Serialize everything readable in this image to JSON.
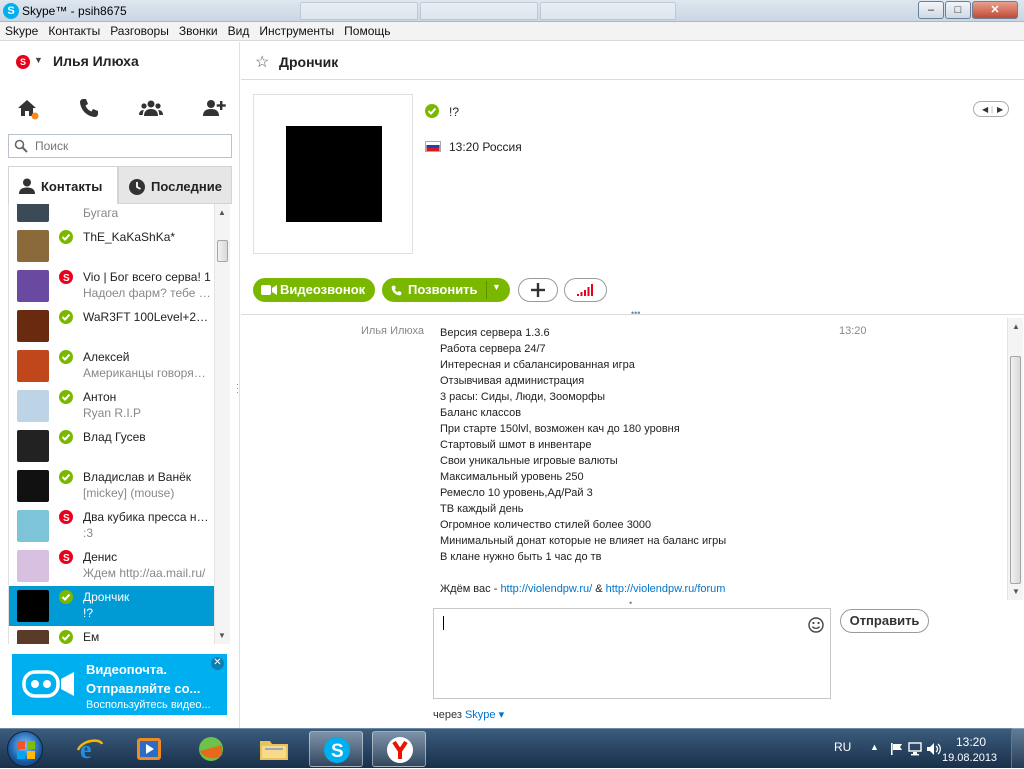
{
  "window": {
    "title": "Skype™ - psih8675",
    "controls": {
      "minimize": "–",
      "maximize": "□",
      "close": "✕"
    }
  },
  "menu": [
    "Skype",
    "Контакты",
    "Разговоры",
    "Звонки",
    "Вид",
    "Инструменты",
    "Помощь"
  ],
  "profile": {
    "name": "Илья Илюха",
    "status": "offline"
  },
  "search": {
    "placeholder": "Поиск"
  },
  "tabs": {
    "contacts": "Контакты",
    "recent": "Последние",
    "active": "contacts"
  },
  "contacts": [
    {
      "name": "",
      "mood": "Бугага",
      "status": "online",
      "avatar": "#3a4a56"
    },
    {
      "name": "ThE_KaKaShKa*",
      "mood": "",
      "status": "online",
      "avatar": "#8a6a3a"
    },
    {
      "name": "Vio | Бог всего серва! 1",
      "mood": "Надоел фарм? тебе сю...",
      "status": "offline",
      "avatar": "#6a4aa0"
    },
    {
      "name": "WaR3FT 100Level+22 h...",
      "mood": "",
      "status": "online",
      "avatar": "#6a2a10"
    },
    {
      "name": "Алексей",
      "mood": "Американцы говорят \"...",
      "status": "online",
      "avatar": "#c0461c"
    },
    {
      "name": "Антон",
      "mood": "Ryan R.I.P",
      "status": "online",
      "avatar": "#bcd4e6"
    },
    {
      "name": "Влад Гусев",
      "mood": "",
      "status": "online",
      "avatar": "#222222"
    },
    {
      "name": "Владислав и Ванёк",
      "mood": "[mickey] (mouse)",
      "status": "online",
      "avatar": "#111111"
    },
    {
      "name": "Два кубика пресса на...",
      "mood": ":3",
      "status": "offline",
      "avatar": "#7ec4d8"
    },
    {
      "name": "Денис",
      "mood": "Ждем http://aa.mail.ru/",
      "status": "offline",
      "avatar": "#d8c0e0"
    },
    {
      "name": "Дрончик",
      "mood": "!?",
      "status": "online",
      "avatar": "#000000",
      "selected": true
    },
    {
      "name": "Ем",
      "mood": "",
      "status": "online",
      "avatar": "#5a3a28"
    }
  ],
  "promo": {
    "title": "Видеопочта.",
    "line2": "Отправляйте со...",
    "line3": "Воспользуйтесь видео...",
    "close": "✕"
  },
  "conversation": {
    "title": "Дрончик",
    "mood": "!?",
    "local_time": "13:20 Россия",
    "buttons": {
      "video": "Видеозвонок",
      "call": "Позвонить"
    }
  },
  "message": {
    "sender": "Илья Илюха",
    "time": "13:20",
    "lines": [
      "Версия сервера 1.3.6",
      "Работа сервера 24/7",
      "Интересная и сбалансированная игра",
      "Отзывчивая администрация",
      "3 расы: Сиды, Люди, Зооморфы",
      "Баланс классов",
      "При старте 150lvl, возможен кач до 180 уровня",
      "Стартовый шмот в инвентаре",
      "Свои уникальные игровые валюты",
      "Максимальный уровень 250",
      "Ремесло 10 уровень,Ад/Рай 3",
      "ТВ каждый день",
      "Огромное количество стилей более 3000",
      "Минимальный донат которые не влияет на баланс игры",
      "В клане нужно быть 1 час до тв"
    ],
    "footer": {
      "prefix": "Ждём вас - ",
      "link1": "http://violendpw.ru/",
      "sep": " & ",
      "link2": "http://violendpw.ru/forum"
    }
  },
  "compose": {
    "send": "Отправить",
    "via_prefix": "через ",
    "via_link": "Skype"
  },
  "taskbar": {
    "lang": "RU",
    "time": "13:20",
    "date": "19.08.2013"
  },
  "colors": {
    "skype_blue": "#00aff0",
    "online_green": "#7ab800",
    "offline_red": "#e8001c",
    "selection": "#009bd5",
    "link": "#0074c8"
  }
}
